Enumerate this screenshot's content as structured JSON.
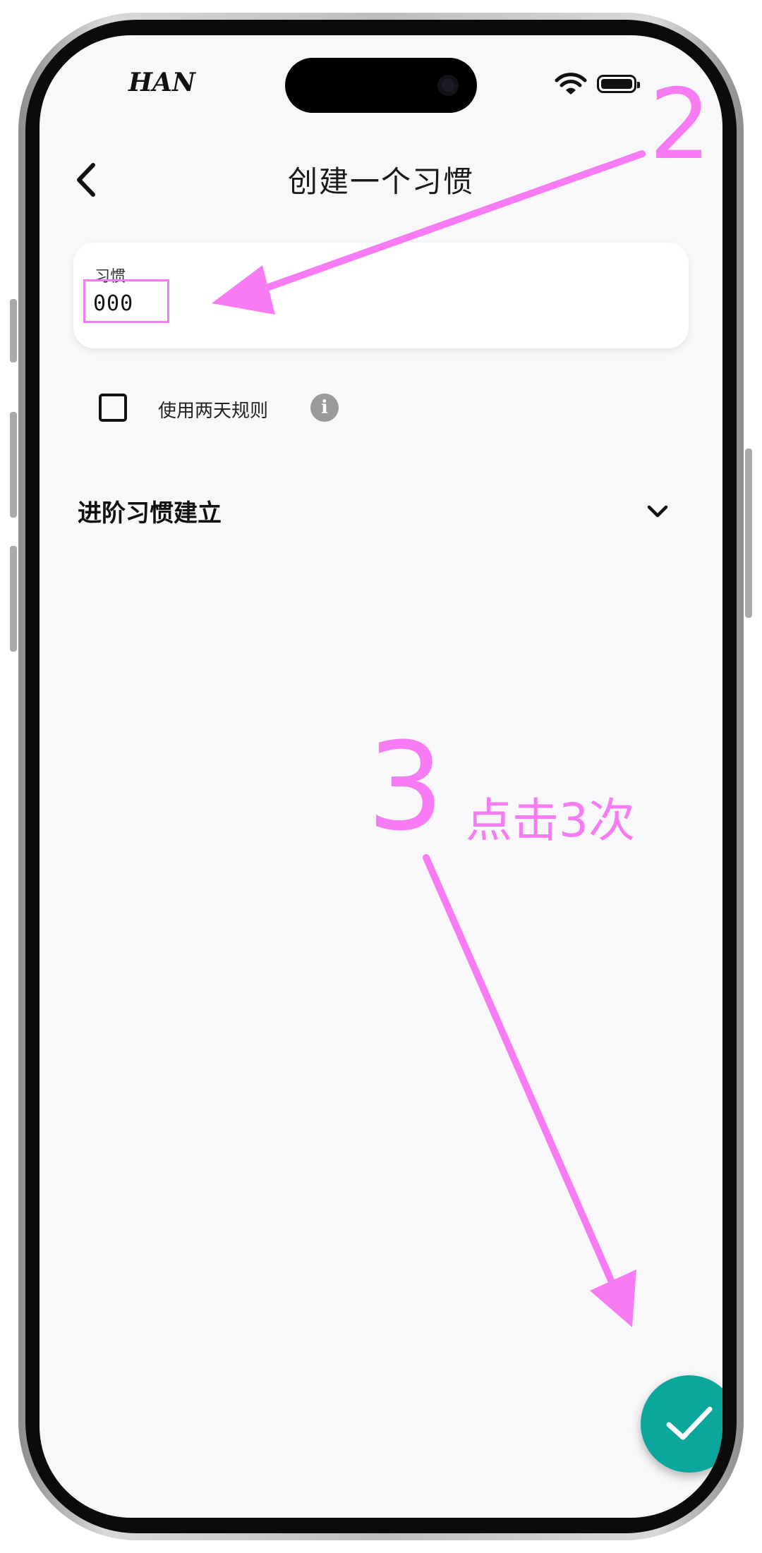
{
  "status_bar": {
    "carrier": "HAN"
  },
  "app_bar": {
    "title": "创建一个习惯"
  },
  "habit_field": {
    "label": "习惯",
    "value": "000"
  },
  "two_day_rule": {
    "label": "使用两天规则",
    "checked": false,
    "info_icon": "info-icon"
  },
  "advanced": {
    "title": "进阶习惯建立",
    "expand_icon": "chevron-down-icon"
  },
  "annotations": {
    "step2": "2",
    "step3": "3",
    "step3_text": "点击3次",
    "color": "#f77cf3"
  },
  "fab": {
    "icon": "check-icon",
    "color": "#0ba79d"
  }
}
